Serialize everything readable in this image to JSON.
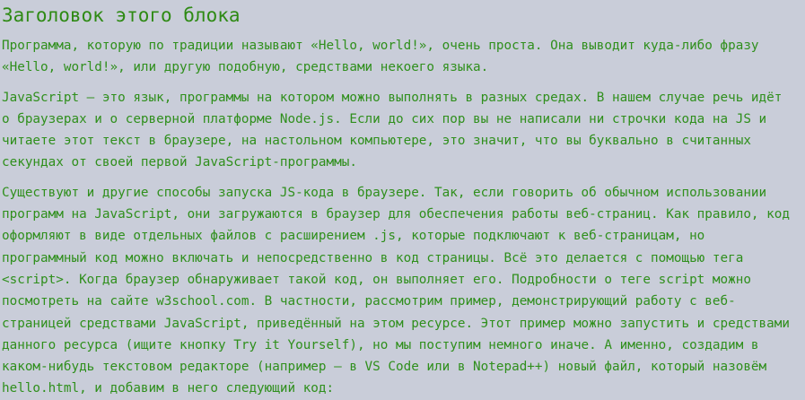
{
  "block": {
    "title": "Заголовок этого блока",
    "paragraphs": [
      "Программа, которую по традиции называют «Hello, world!», очень проста. Она выводит куда-либо фразу «Hello, world!», или другую подобную, средствами некоего языка.",
      "JavaScript — это язык, программы на котором можно выполнять в разных средах. В нашем случае речь идёт о браузерах и о серверной платформе Node.js. Если до сих пор вы не написали ни строчки кода на JS и читаете этот текст в браузере, на настольном компьютере, это значит, что вы буквально в считанных секундах от своей первой JavaScript-программы.",
      "Существуют и другие способы запуска JS-кода в браузере. Так, если говорить об обычном использовании программ на JavaScript, они загружаются в браузер для обеспечения работы веб-страниц. Как правило, код оформляют в виде отдельных файлов с расширением .js, которые подключают к веб-страницам, но программный код можно включать и непосредственно в код страницы. Всё это делается с помощью тега <script>. Когда браузер обнаруживает такой код, он выполняет его. Подробности о теге script можно посмотреть на сайте w3school.com. В частности, рассмотрим пример, демонстрирующий работу с веб-страницей средствами JavaScript, приведённый на этом ресурсе. Этот пример можно запустить и средствами данного ресурса (ищите кнопку Try it Yourself), но мы поступим немного иначе. А именно, создадим в каком-нибудь текстовом редакторе (например — в VS Code или в Notepad++) новый файл, который назовём hello.html, и добавим в него следующий код:"
    ]
  },
  "colors": {
    "background": "#c9cdd9",
    "heading": "#2e8a14",
    "text": "#2f8f1c"
  }
}
